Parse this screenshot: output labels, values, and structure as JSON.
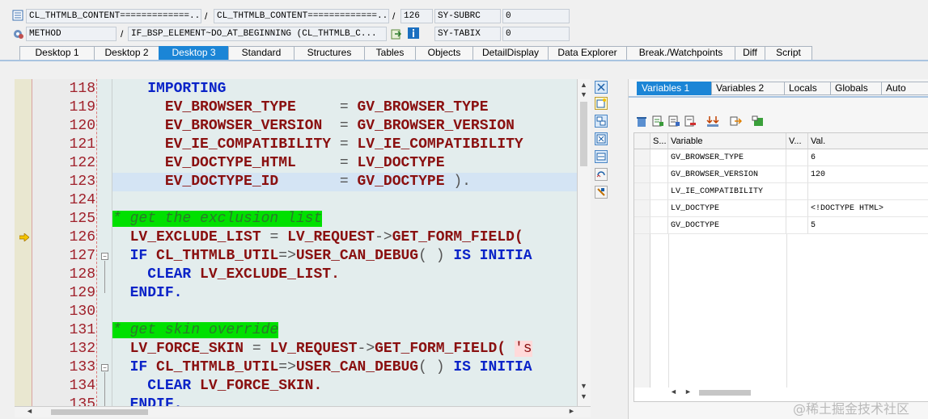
{
  "header": {
    "row1": {
      "program": "CL_THTMLB_CONTENT=============...",
      "include": "CL_THTMLB_CONTENT=============...",
      "line": "126",
      "sysvar_name": "SY-SUBRC",
      "sysvar_value": "0"
    },
    "row2": {
      "type": "METHOD",
      "method": "IF_BSP_ELEMENT~DO_AT_BEGINNING (CL_THTMLB_C...",
      "sysvar_name": "SY-TABIX",
      "sysvar_value": "0"
    },
    "sep": "/"
  },
  "tabs": [
    "Desktop 1",
    "Desktop 2",
    "Desktop 3",
    "Standard",
    "Structures",
    "Tables",
    "Objects",
    "DetailDisplay",
    "Data Explorer",
    "Break./Watchpoints",
    "Diff",
    "Script"
  ],
  "active_tab": "Desktop 3",
  "code": {
    "line_numbers": [
      "118",
      "119",
      "120",
      "121",
      "122",
      "123",
      "124",
      "125",
      "126",
      "127",
      "128",
      "129",
      "130",
      "131",
      "132",
      "133",
      "134",
      "135"
    ],
    "current_line": "126",
    "lines": {
      "l118": {
        "kw": "IMPORTING"
      },
      "l119": {
        "a": "EV_BROWSER_TYPE",
        "eq": "=",
        "b": "GV_BROWSER_TYPE"
      },
      "l120": {
        "a": "EV_BROWSER_VERSION",
        "eq": "=",
        "b": "GV_BROWSER_VERSION"
      },
      "l121": {
        "a": "EV_IE_COMPATIBILITY",
        "eq": "=",
        "b": "LV_IE_COMPATIBILITY"
      },
      "l122": {
        "a": "EV_DOCTYPE_HTML",
        "eq": "=",
        "b": "LV_DOCTYPE"
      },
      "l123": {
        "a": "EV_DOCTYPE_ID",
        "eq": "=",
        "b": "GV_DOCTYPE",
        "end": ")."
      },
      "l125": {
        "comment": "* get the exclusion list"
      },
      "l126": {
        "a": "LV_EXCLUDE_LIST",
        "eq": "=",
        "b": "LV_REQUEST",
        "arrow": "->",
        "c": "GET_FORM_FIELD("
      },
      "l127": {
        "kw1": "IF",
        "a": "CL_THTMLB_UTIL",
        "arrow": "=>",
        "b": "USER_CAN_DEBUG",
        "p": "( )",
        "kw2": "IS",
        "kw3": "INITIA"
      },
      "l128": {
        "kw": "CLEAR",
        "a": "LV_EXCLUDE_LIST."
      },
      "l129": {
        "kw": "ENDIF."
      },
      "l131": {
        "comment": "* get skin override"
      },
      "l132": {
        "a": "LV_FORCE_SKIN",
        "eq": "=",
        "b": "LV_REQUEST",
        "arrow": "->",
        "c": "GET_FORM_FIELD(",
        "s": "'s"
      },
      "l133": {
        "kw1": "IF",
        "a": "CL_THTMLB_UTIL",
        "arrow": "=>",
        "b": "USER_CAN_DEBUG",
        "p": "( )",
        "kw2": "IS",
        "kw3": "INITIA"
      },
      "l134": {
        "kw": "CLEAR",
        "a": "LV_FORCE_SKIN."
      },
      "l135": {
        "kw": "ENDIF."
      }
    }
  },
  "variables": {
    "tabs": [
      "Variables 1",
      "Variables 2",
      "Locals",
      "Globals",
      "Auto"
    ],
    "active_tab": "Variables 1",
    "columns": [
      "S...",
      "Variable",
      "V...",
      "Val."
    ],
    "rows": [
      {
        "name": "GV_BROWSER_TYPE",
        "value": "6"
      },
      {
        "name": "GV_BROWSER_VERSION",
        "value": "120"
      },
      {
        "name": "LV_IE_COMPATIBILITY",
        "value": ""
      },
      {
        "name": "LV_DOCTYPE",
        "value": "<!DOCTYPE HTML>"
      },
      {
        "name": "GV_DOCTYPE",
        "value": "5"
      }
    ]
  },
  "watermark": "@稀土掘金技术社区",
  "colors": {
    "accent": "#1b85d6",
    "comment_bg": "#00e000",
    "keyword": "#0a23c8",
    "identifier": "#8a1010"
  }
}
